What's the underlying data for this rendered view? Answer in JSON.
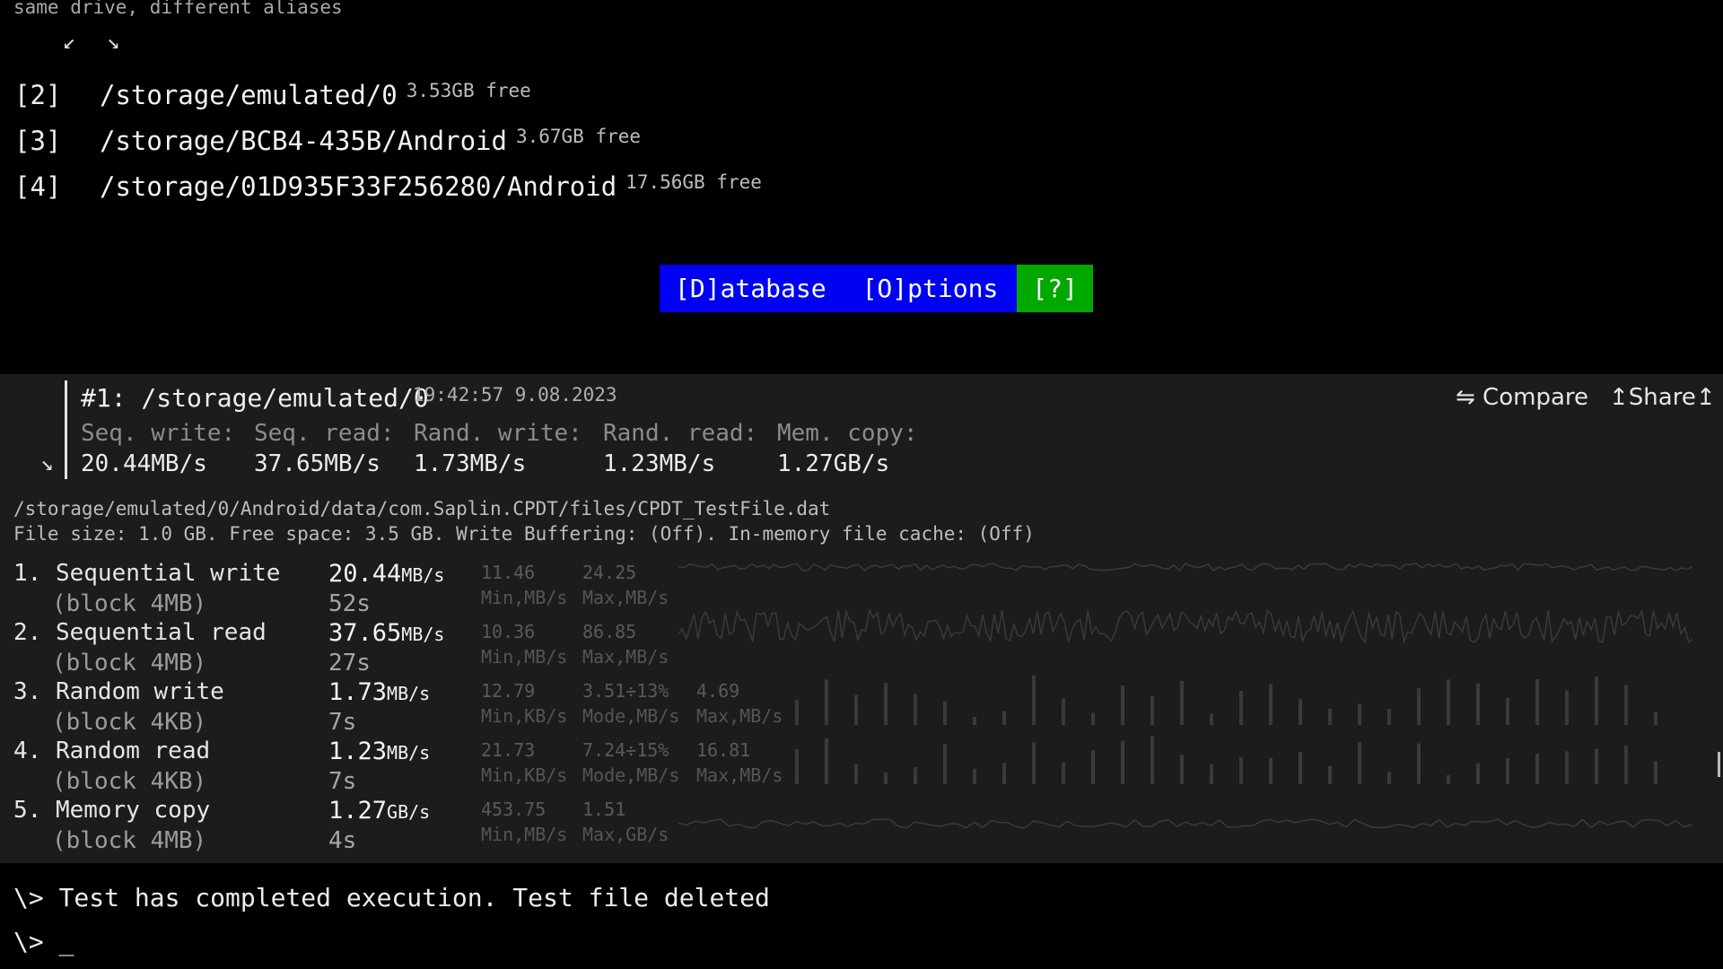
{
  "top": {
    "note": "same drive, different aliases",
    "arrows": "↙ ↘",
    "drives": [
      {
        "index": "[2]",
        "path": "/storage/emulated/0",
        "free": "3.53GB free"
      },
      {
        "index": "[3]",
        "path": "/storage/BCB4-435B/Android",
        "free": "3.67GB free"
      },
      {
        "index": "[4]",
        "path": "/storage/01D935F33F256280/Android",
        "free": "17.56GB free"
      }
    ]
  },
  "menu": {
    "database": "[D]atabase",
    "options": "[O]ptions",
    "help": "[?]"
  },
  "card": {
    "title": "#1: /storage/emulated/0",
    "timestamp": "19:42:57 9.08.2023",
    "toggle": "↘",
    "compare": "⇋ Compare",
    "share": "↥Share↥",
    "summary_labels": [
      "Seq. write:",
      "Seq. read:",
      "Rand. write:",
      "Rand. read:",
      "Mem. copy:"
    ],
    "summary_values": [
      "20.44MB/s",
      "37.65MB/s",
      "1.73MB/s",
      "1.23MB/s",
      "1.27GB/s"
    ],
    "file_path": "/storage/emulated/0/Android/data/com.Saplin.CPDT/files/CPDT_TestFile.dat",
    "file_info": "File size: 1.0 GB. Free space: 3.5 GB. Write Buffering: (Off). In-memory file cache: (Off)",
    "tests": [
      {
        "name": "1. Sequential write",
        "block": "(block 4MB)",
        "value": "20.44",
        "unit": "MB/s",
        "duration": "52s",
        "stats": [
          {
            "v": "11.46",
            "l": "Min,MB/s"
          },
          {
            "v": "24.25",
            "l": "Max,MB/s"
          }
        ]
      },
      {
        "name": "2. Sequential read",
        "block": "(block 4MB)",
        "value": "37.65",
        "unit": "MB/s",
        "duration": "27s",
        "stats": [
          {
            "v": "10.36",
            "l": "Min,MB/s"
          },
          {
            "v": "86.85",
            "l": "Max,MB/s"
          }
        ]
      },
      {
        "name": "3. Random write",
        "block": "(block 4KB)",
        "value": "1.73",
        "unit": "MB/s",
        "duration": "7s",
        "stats": [
          {
            "v": "12.79",
            "l": "Min,KB/s"
          },
          {
            "v": "3.51÷13%",
            "l": "Mode,MB/s"
          },
          {
            "v": "4.69",
            "l": "Max,MB/s"
          }
        ]
      },
      {
        "name": "4. Random read",
        "block": "(block 4KB)",
        "value": "1.23",
        "unit": "MB/s",
        "duration": "7s",
        "stats": [
          {
            "v": "21.73",
            "l": "Min,KB/s"
          },
          {
            "v": "7.24÷15%",
            "l": "Mode,MB/s"
          },
          {
            "v": "16.81",
            "l": "Max,MB/s"
          }
        ]
      },
      {
        "name": "5. Memory copy",
        "block": "(block 4MB)",
        "value": "1.27",
        "unit": "GB/s",
        "duration": "4s",
        "stats": [
          {
            "v": "453.75",
            "l": "Min,MB/s"
          },
          {
            "v": "1.51",
            "l": "Max,GB/s"
          }
        ]
      }
    ]
  },
  "terminal": {
    "line1": "\\> Test has completed execution. Test file deleted",
    "line2": "\\> _"
  },
  "colors": {
    "menu_blue": "#0000f2",
    "help_green": "#00a800",
    "card_bg": "#1c1c1c",
    "graph_line": "#3a3a3a"
  }
}
